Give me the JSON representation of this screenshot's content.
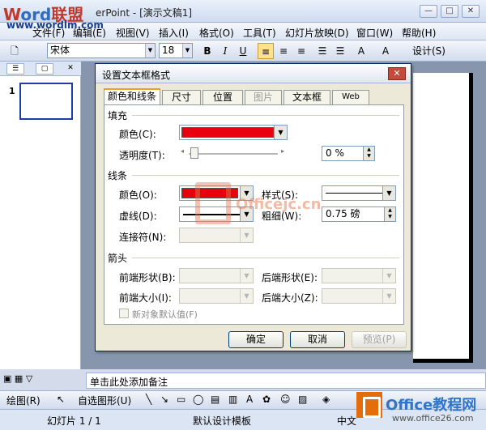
{
  "window": {
    "title": "Microsoft PowerPoint - [演示文稿1]",
    "title_visible": "erPoint - [演示文稿1]",
    "watermark_logo": {
      "w1": "W",
      "w2": "ord",
      "w3": "联盟"
    },
    "watermark_url": "www.wordlm.com",
    "min_label": "—",
    "max_label": "□",
    "close_label": "✕"
  },
  "menubar": {
    "items": [
      "文件(F)",
      "编辑(E)",
      "视图(V)",
      "插入(I)",
      "格式(O)",
      "工具(T)",
      "幻灯片放映(D)",
      "窗口(W)",
      "帮助(H)"
    ]
  },
  "toolbar": {
    "font_name": "宋体",
    "font_size": "18",
    "bold": "B",
    "italic": "I",
    "underline": "U",
    "design_label": "设计(S)"
  },
  "left_pane": {
    "slide_number": "1"
  },
  "notes": {
    "placeholder": "单击此处添加备注"
  },
  "draw_bar": {
    "draw_label": "绘图(R)",
    "autoshapes_label": "自选图形(U)"
  },
  "status": {
    "slide": "幻灯片 1 / 1",
    "template": "默认设计模板",
    "language": "中文"
  },
  "bottom_logo": {
    "text": "Office教程网",
    "url": "www.office26.com"
  },
  "dialog": {
    "title": "设置文本框格式",
    "close_label": "✕",
    "tabs": [
      "颜色和线条",
      "尺寸",
      "位置",
      "图片",
      "文本框",
      "Web"
    ],
    "fill": {
      "section": "填充",
      "color_label": "颜色(C):",
      "color_value": "#e8000f",
      "transparency_label": "透明度(T):",
      "transparency_value": "0 %",
      "transparency_fraction": 0
    },
    "line": {
      "section": "线条",
      "color_label": "颜色(O):",
      "color_value": "#e8000f",
      "dashed_label": "虚线(D):",
      "connector_label": "连接符(N):",
      "style_label": "样式(S):",
      "weight_label": "粗细(W):",
      "weight_value": "0.75 磅"
    },
    "arrows": {
      "section": "箭头",
      "begin_style_label": "前端形状(B):",
      "begin_size_label": "前端大小(I):",
      "end_style_label": "后端形状(E):",
      "end_size_label": "后端大小(Z):"
    },
    "default_checkbox_label": "新对象默认值(F)",
    "ok_label": "确定",
    "cancel_label": "取消",
    "preview_label": "预览(P)"
  },
  "watermark": {
    "text": "Officejc.cn"
  }
}
